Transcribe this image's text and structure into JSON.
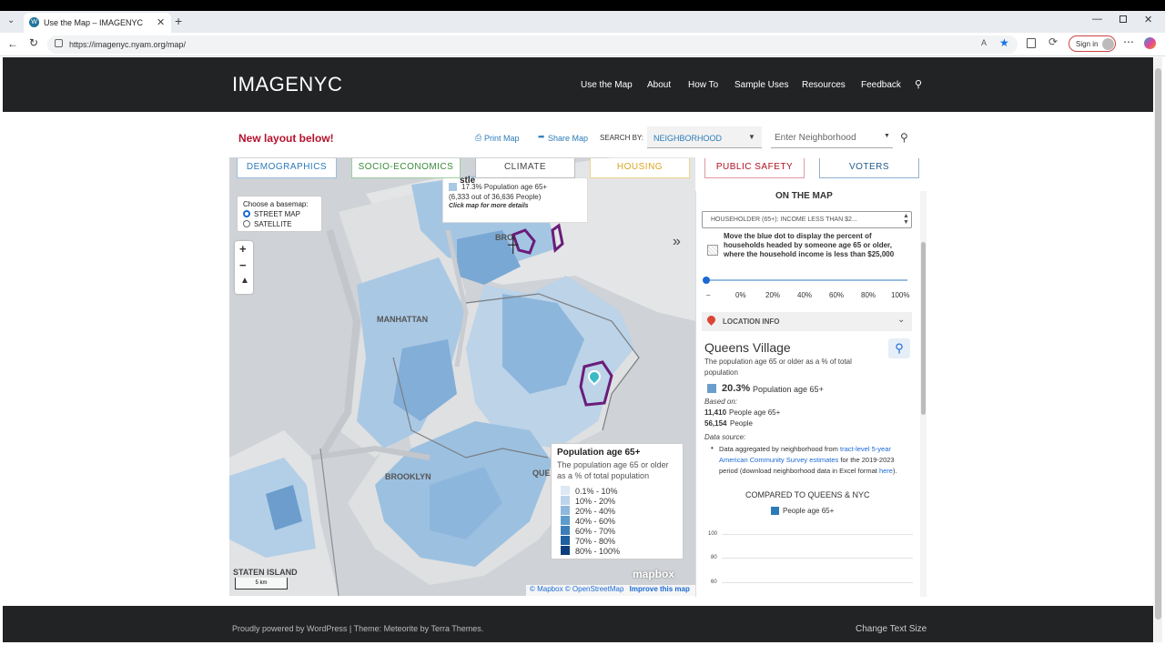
{
  "browser": {
    "tab_title": "Use the Map – IMAGENYC",
    "url": "https://imagenyc.nyam.org/map/",
    "sign_in": "Sign in"
  },
  "site": {
    "logo": "IMAGENYC",
    "nav": [
      "Use the Map",
      "About",
      "How To",
      "Sample Uses",
      "Resources",
      "Feedback"
    ]
  },
  "toolbar": {
    "notice": "New layout below!",
    "print": "Print Map",
    "share": "Share Map",
    "search_by_label": "SEARCH BY:",
    "search_by_value": "NEIGHBORHOOD",
    "search_placeholder": "Enter Neighborhood"
  },
  "categories": [
    {
      "label": "DEMOGRAPHICS",
      "color": "#2b7bb9"
    },
    {
      "label": "SOCIO-ECONOMICS",
      "color": "#3a8a3a"
    },
    {
      "label": "CLIMATE",
      "color": "#444444"
    },
    {
      "label": "HOUSING",
      "color": "#d9a520"
    },
    {
      "label": "PUBLIC SAFETY",
      "color": "#b01020"
    },
    {
      "label": "VOTERS",
      "color": "#1e5a8c"
    }
  ],
  "map": {
    "basemap_label": "Choose a basemap:",
    "basemap_options": [
      "STREET MAP",
      "SATELLITE"
    ],
    "basemap_selected": "STREET MAP",
    "tooltip_title": "stle",
    "tooltip_line1": "17.3% Population age 65+",
    "tooltip_line2": "(6,333 out of 36,636 People)",
    "tooltip_line3": "Click map for more details",
    "labels": {
      "manhattan": "MANHATTAN",
      "brooklyn": "BROOKLYN",
      "queens": "QUE",
      "staten": "STATEN ISLAND",
      "bronx": "BRO"
    },
    "scale": "5 km",
    "attribution": "© Mapbox © OpenStreetMap",
    "improve": "Improve this map",
    "mapbox": "mapbox"
  },
  "legend": {
    "title": "Population age 65+",
    "subtitle": "The population age 65 or older as a % of total population",
    "bins": [
      {
        "label": "0.1% - 10%",
        "color": "#dce8f3"
      },
      {
        "label": "10% - 20%",
        "color": "#bdd5ea"
      },
      {
        "label": "20% - 40%",
        "color": "#8fb8dc"
      },
      {
        "label": "40% - 60%",
        "color": "#5e9ccb"
      },
      {
        "label": "60% - 70%",
        "color": "#3c7fb8"
      },
      {
        "label": "70% - 80%",
        "color": "#2060a0"
      },
      {
        "label": "80% - 100%",
        "color": "#0c3f7a"
      }
    ]
  },
  "panel": {
    "heading": "ON THE MAP",
    "dropdown": "HOUSEHOLDER (65+): INCOME LESS THAN $2...",
    "description": "Move the blue dot to display the percent of households headed by someone age 65 or older, where the household income is less than $25,000",
    "slider_value_pct": 0,
    "ticks": [
      "–",
      "0%",
      "20%",
      "40%",
      "60%",
      "80%",
      "100%"
    ],
    "location_info": "LOCATION INFO",
    "place": "Queens Village",
    "place_desc": "The population age 65 or older as a % of total population",
    "pct": "20.3%",
    "pct_label": "Population age 65+",
    "based_on": "Based on:",
    "count1": "11,410",
    "count1_label": "People age 65+",
    "count2": "56,154",
    "count2_label": "People",
    "data_source": "Data source:",
    "source_a": "Data aggregated by neighborhood from ",
    "source_link": "tract-level 5-year American Community Survey estimates",
    "source_b": " for the 2019-2023 period (download neighborhood data in Excel format ",
    "source_here": "here",
    "source_c": ").",
    "compared": "COMPARED TO QUEENS & NYC",
    "chart_legend": "People age 65+",
    "chart_ticks": [
      "100",
      "80",
      "60"
    ]
  },
  "footer": {
    "left": "Proudly powered by WordPress | Theme: Meteorite by Terra Themes.",
    "right": "Change Text Size"
  }
}
